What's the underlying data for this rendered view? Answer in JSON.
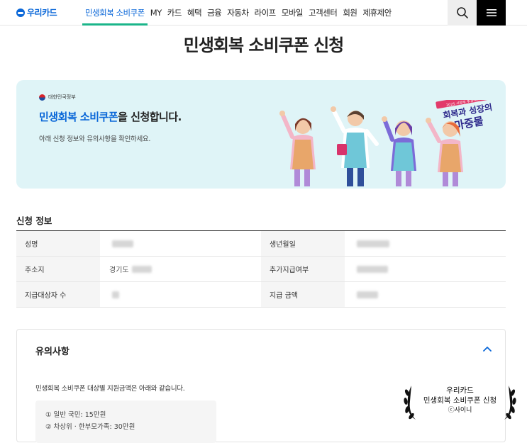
{
  "header": {
    "logo_text": "우리카드",
    "nav": [
      {
        "label": "민생회복 소비쿠폰",
        "active": true
      },
      {
        "label": "MY"
      },
      {
        "label": "카드"
      },
      {
        "label": "혜택"
      },
      {
        "label": "금융"
      },
      {
        "label": "자동차"
      },
      {
        "label": "라이프"
      },
      {
        "label": "모바일"
      },
      {
        "label": "고객센터"
      },
      {
        "label": "회원"
      },
      {
        "label": "제휴제안"
      }
    ],
    "icons": {
      "search": "search-icon",
      "menu": "hamburger-menu-icon"
    }
  },
  "page": {
    "title": "민생회복 소비쿠폰 신청"
  },
  "banner": {
    "gov_label": "대한민국정부",
    "headline_highlight": "민생회복 소비쿠폰",
    "headline_rest": "을 신청합니다.",
    "subtext": "아래 신청 정보와 유의사항을 확인하세요.",
    "badge_top": "2025 시장부 추경예산",
    "badge_line1": "회복과 성장의",
    "badge_line2": "마중물",
    "colors": {
      "background": "#dff4f7",
      "highlight": "#0a67d8"
    }
  },
  "info": {
    "section_title": "신청 정보",
    "rows": [
      {
        "label_a": "성명",
        "value_a": "",
        "label_b": "생년월일",
        "value_b": ""
      },
      {
        "label_a": "주소지",
        "value_a": "경기도",
        "label_b": "추가지급여부",
        "value_b": ""
      },
      {
        "label_a": "지급대상자 수",
        "value_a": "",
        "label_b": "지급 금액",
        "value_b": ""
      }
    ]
  },
  "notice": {
    "title": "유의사항",
    "text": "민생회복 소비쿠폰 대상별 지원금액은 아래와 같습니다.",
    "items": [
      "① 일반 국민: 15만원",
      "② 차상위 · 한부모가족: 30만원"
    ]
  },
  "watermark": {
    "line1": "우리카드",
    "line2": "민생회복 소비쿠폰 신청",
    "line3": "ⓒ사이니"
  }
}
